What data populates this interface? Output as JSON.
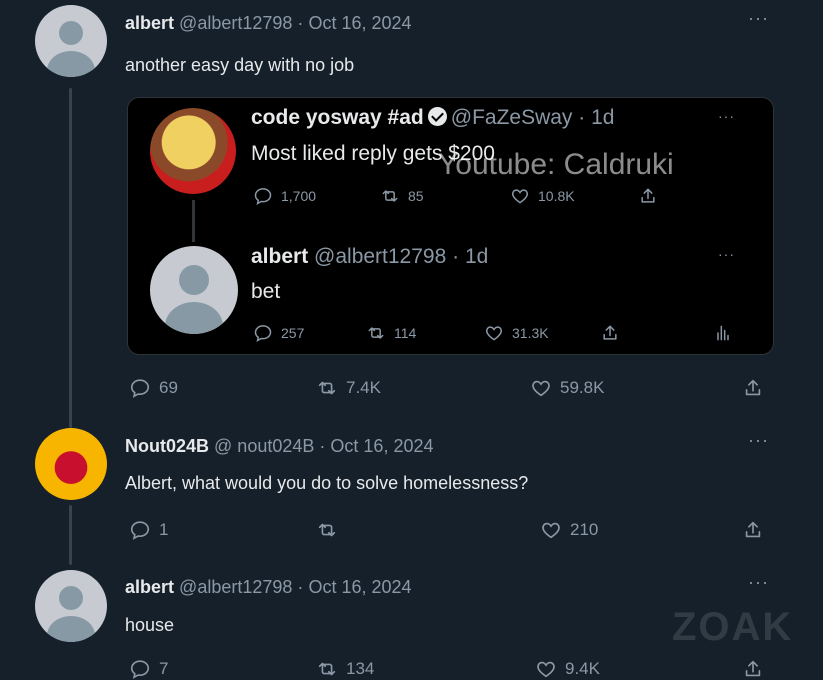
{
  "tweets": [
    {
      "name": "albert",
      "handle": "@albert12798",
      "sep": "·",
      "date": "Oct 16, 2024",
      "text": "another easy day with no job",
      "replies": "69",
      "retweets": "7.4K",
      "likes": "59.8K"
    },
    {
      "name": "Nout024B",
      "handle": "@ nout024B",
      "sep": "·",
      "date": "Oct 16, 2024",
      "text": "Albert, what would you do to solve homelessness?",
      "replies": "1",
      "retweets": "",
      "likes": "210"
    },
    {
      "name": "albert",
      "handle": "@albert12798",
      "sep": "·",
      "date": "Oct 16, 2024",
      "text": "house",
      "replies": "7",
      "retweets": "134",
      "likes": "9.4K"
    }
  ],
  "quote": {
    "tweet1": {
      "name": "code yosway #ad",
      "handle": "@FaZeSway",
      "time": "· 1d",
      "text": "Most liked reply gets $200",
      "replies": "1,700",
      "retweets": "85",
      "likes": "10.8K"
    },
    "tweet2": {
      "name": "albert",
      "handle": "@albert12798",
      "time": "· 1d",
      "text": "bet",
      "replies": "257",
      "retweets": "114",
      "likes": "31.3K"
    }
  },
  "more_label": "···",
  "watermark": "Youtube: Caldruki",
  "watermark2": "ZOAK",
  "colors": {
    "background": "#15202b",
    "card": "#000000",
    "muted": "#8b98a5"
  }
}
